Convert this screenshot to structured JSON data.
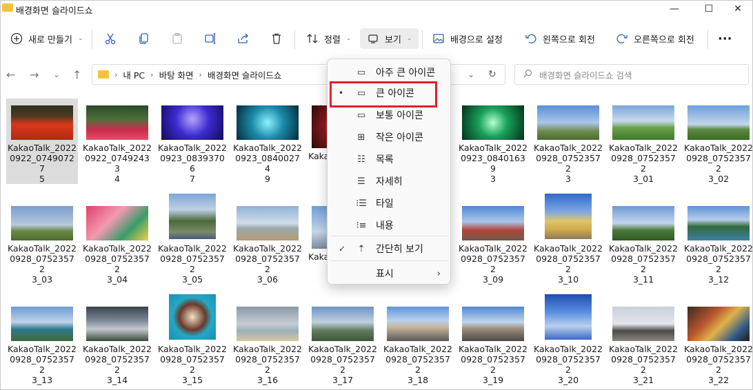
{
  "window": {
    "title": "배경화면 슬라이드쇼",
    "controls": {
      "minimize": "—",
      "maximize": "☐",
      "close": "✕"
    }
  },
  "toolbar": {
    "new_label": "새로 만들기",
    "sort_label": "정렬",
    "view_label": "보기",
    "set_background_label": "배경으로 설정",
    "rotate_left_label": "왼쪽으로 회전",
    "rotate_right_label": "오른쪽으로 회전",
    "more_label": "···"
  },
  "nav": {
    "back": "←",
    "forward": "→",
    "recent": "⌄",
    "up": "↑",
    "breadcrumb": [
      "내 PC",
      "바탕 화면",
      "배경화면 슬라이드쇼"
    ],
    "search_placeholder": "배경화면 슬라이드쇼 검색"
  },
  "view_menu": {
    "items": [
      {
        "label": "아주 큰 아이콘",
        "mark": "",
        "icon": "extra-large-icons-icon"
      },
      {
        "label": "큰 아이콘",
        "mark": "•",
        "icon": "large-icons-icon"
      },
      {
        "label": "보통 아이콘",
        "mark": "",
        "icon": "medium-icons-icon"
      },
      {
        "label": "작은 아이콘",
        "mark": "",
        "icon": "small-icons-icon"
      },
      {
        "label": "목록",
        "mark": "",
        "icon": "list-icon"
      },
      {
        "label": "자세히",
        "mark": "",
        "icon": "details-icon"
      },
      {
        "label": "타일",
        "mark": "",
        "icon": "tiles-icon"
      },
      {
        "label": "내용",
        "mark": "",
        "icon": "content-icon"
      },
      {
        "label": "간단히 보기",
        "mark": "✓",
        "icon": "compact-view-icon"
      },
      {
        "label": "표시",
        "mark": "",
        "icon": ""
      }
    ],
    "submenu_arrow": "›"
  },
  "files": [
    "KakaoTalk_20220922_074907275",
    "KakaoTalk_20220922_074924334",
    "KakaoTalk_20220923_083937067",
    "KakaoTalk_20220923_084002749",
    "KakaoTalk_2022",
    "KakaoTalk_2022",
    "KakaoTalk_20220923_084016393",
    "KakaoTalk_20220928_075235723",
    "KakaoTalk_20220928_075235723_01",
    "KakaoTalk_20220928_075235723_02",
    "KakaoTalk_20220928_075235723_03",
    "KakaoTalk_20220928_075235723_04",
    "KakaoTalk_20220928_075235723_05",
    "KakaoTalk_20220928_075235723_06",
    "KakaoTalk_2022",
    "KakaoTalk_20220928_075235723_09",
    "KakaoTalk_20220928_075235723_10",
    "KakaoTalk_20220928_075235723_11",
    "KakaoTalk_20220928_075235723_12",
    "KakaoTalk_20220928_075235723_13",
    "KakaoTalk_20220928_075235723_14",
    "KakaoTalk_20220928_075235723_15",
    "KakaoTalk_20220928_075235723_16",
    "KakaoTalk_20220928_075235723_17",
    "KakaoTalk_20220928_075235723_18",
    "KakaoTalk_20220928_075235723_19",
    "KakaoTalk_20220928_075235723_20",
    "KakaoTalk_20220928_075235723_21",
    "KakaoTalk_20220928_075235723_22"
  ],
  "files_display": [
    "KakaoTalk_2022\n0922_07490727\n5",
    "KakaoTalk_2022\n0922_07492433\n4",
    "KakaoTalk_2022\n0923_08393706\n7",
    "KakaoTalk_2022\n0923_08400274\n9",
    "KakaoTalk_2022\n0923_08401639\n3",
    "KakaoTalk_2022\n0928_07523572\n3",
    "KakaoTalk_2022\n0928_07523572\n3_01",
    "KakaoTalk_2022\n0928_07523572\n3_02",
    "KakaoTalk_2022\n0928_07523572\n3_03",
    "KakaoTalk_2022\n0928_07523572\n3_04",
    "KakaoTalk_2022\n0928_07523572\n3_05",
    "KakaoTalk_2022\n0928_07523572\n3_06",
    "KakaoTalk_2022\n0928_07523572\n3_09",
    "KakaoTalk_2022\n0928_07523572\n3_10",
    "KakaoTalk_2022\n0928_07523572\n3_11",
    "KakaoTalk_2022\n0928_07523572\n3_12",
    "KakaoTalk_2022\n0928_07523572\n3_13",
    "KakaoTalk_2022\n0928_07523572\n3_14",
    "KakaoTalk_2022\n0928_07523572\n3_15",
    "KakaoTalk_2022\n0928_07523572\n3_16",
    "KakaoTalk_2022\n0928_07523572\n3_17",
    "KakaoTalk_2022\n0928_07523572\n3_18",
    "KakaoTalk_2022\n0928_07523572\n3_19",
    "KakaoTalk_2022\n0928_07523572\n3_20",
    "KakaoTalk_2022\n0928_07523572\n3_21",
    "KakaoTalk_2022\n0928_07523572\n3_22"
  ],
  "colors": {
    "accent": "#2b5fb3",
    "highlight": "#e0202a",
    "folder": "#f5c33b"
  }
}
